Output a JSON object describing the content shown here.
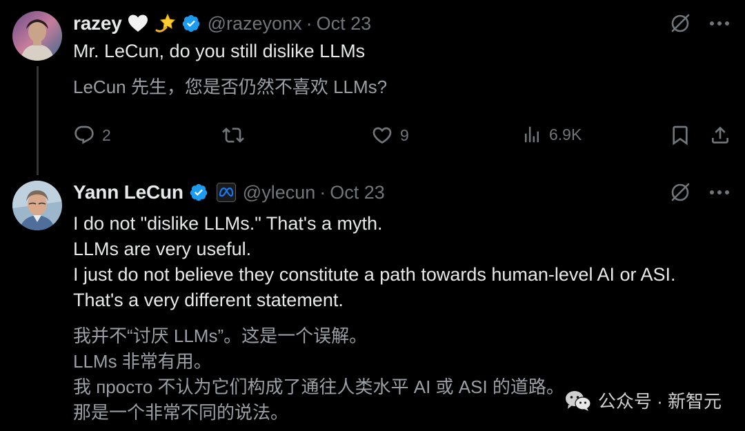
{
  "colors": {
    "background": "#000000",
    "primary_text": "#e7e9ea",
    "secondary_text": "#71767b",
    "verified_blue": "#1d9bf0",
    "thread_line": "#333639"
  },
  "tweets": [
    {
      "author": {
        "name": "razey",
        "emojis": [
          "white-heart-icon",
          "dizzy-star-icon"
        ],
        "verified": true,
        "handle": "@razeyonx"
      },
      "separator": "·",
      "date": "Oct 23",
      "text": "Mr. LeCun, do you still dislike LLMs",
      "translation": "LeCun 先生，您是否仍然不喜欢 LLMs?",
      "stats": {
        "replies": "2",
        "retweets": "",
        "likes": "9",
        "views": "6.9K"
      },
      "action_icons": [
        "grok-icon",
        "more-icon"
      ]
    },
    {
      "author": {
        "name": "Yann LeCun",
        "verified": true,
        "affiliation": "meta-logo-icon",
        "handle": "@ylecun"
      },
      "separator": "·",
      "date": "Oct 23",
      "text_lines": [
        "I do not \"dislike LLMs.\" That's a myth.",
        "LLMs are very useful.",
        "I just do not believe they constitute a path towards human-level AI or ASI.",
        "That's a very different statement."
      ],
      "translation_lines": [
        "我并不“讨厌 LLMs”。这是一个误解。",
        "LLMs 非常有用。",
        "我 просто 不认为它们构成了通往人类水平 AI 或 ASI 的道路。",
        "那是一个非常不同的说法。"
      ],
      "action_icons": [
        "grok-icon",
        "more-icon"
      ]
    }
  ],
  "watermark": {
    "icon": "wechat-icon",
    "text": "公众号 · 新智元"
  }
}
